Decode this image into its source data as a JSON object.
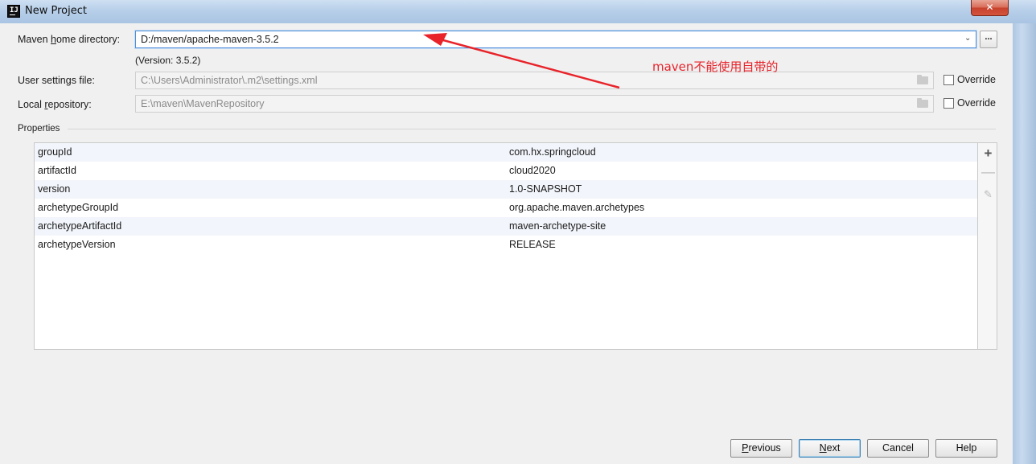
{
  "window": {
    "title": "New Project",
    "app_icon": "IJ",
    "close_glyph": "✕"
  },
  "maven": {
    "home_label_pre": "Maven ",
    "home_label_mnemonic": "h",
    "home_label_post": "ome directory:",
    "home_value": "D:/maven/apache-maven-3.5.2",
    "browse_label": "...",
    "version_note": "(Version: 3.5.2)",
    "settings_label": "User settings file:",
    "settings_value": "C:\\Users\\Administrator\\.m2\\settings.xml",
    "repo_label_pre": "Local ",
    "repo_label_mnemonic": "r",
    "repo_label_post": "epository:",
    "repo_value": "E:\\maven\\MavenRepository",
    "override_label": "Override",
    "override_label_2": "Override"
  },
  "properties": {
    "section_label": "Properties",
    "rows": [
      {
        "key": "groupId",
        "value": "com.hx.springcloud"
      },
      {
        "key": "artifactId",
        "value": "cloud2020"
      },
      {
        "key": "version",
        "value": "1.0-SNAPSHOT"
      },
      {
        "key": "archetypeGroupId",
        "value": "org.apache.maven.archetypes"
      },
      {
        "key": "archetypeArtifactId",
        "value": "maven-archetype-site"
      },
      {
        "key": "archetypeVersion",
        "value": "RELEASE"
      }
    ],
    "add_glyph": "+",
    "remove_glyph": "—",
    "edit_glyph": "✎"
  },
  "buttons": {
    "previous_mnemonic": "P",
    "previous_rest": "revious",
    "next_mnemonic": "N",
    "next_rest": "ext",
    "cancel": "Cancel",
    "help": "Help"
  },
  "annotation": {
    "text": "maven不能使用自带的",
    "color": "#e8232a"
  }
}
